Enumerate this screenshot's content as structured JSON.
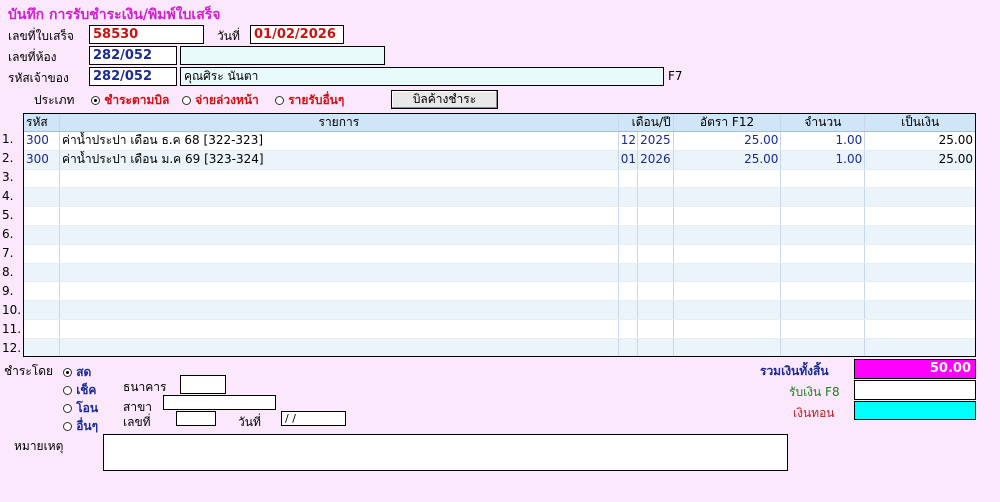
{
  "title": "บันทึก การรับชำระเงิน/พิมพ์ใบเสร็จ",
  "receipt": {
    "label": "เลขที่ใบเสร็จ",
    "value": "58530"
  },
  "date": {
    "label": "วันที่",
    "value": "01/02/2026"
  },
  "room": {
    "label": "เลขที่ห้อง",
    "value": "282/052",
    "extra": ""
  },
  "owner": {
    "label": "รหัสเจ้าของ",
    "code": "282/052",
    "name": "คุณศิระ นันตา",
    "hotkey": "F7"
  },
  "type": {
    "label": "ประเภท",
    "options": [
      "ชำระตามบิล",
      "จ่ายล่วงหน้า",
      "รายรับอื่นๆ"
    ],
    "selected": 0,
    "button": "บิลค้างชำระ"
  },
  "table": {
    "headers": {
      "code": "รหัส",
      "item": "รายการ",
      "month_year": "เดือน/ปี",
      "rate": "อัตรา F12",
      "qty": "จำนวน",
      "amount": "เป็นเงิน"
    },
    "row_numbers": [
      "1.",
      "2.",
      "3.",
      "4.",
      "5.",
      "6.",
      "7.",
      "8.",
      "9.",
      "10.",
      "11.",
      "12."
    ],
    "rows": [
      {
        "code": "300",
        "item": "ค่าน้ำประปา เดือน ธ.ค 68 [322-323]",
        "month": "12",
        "year": "2025",
        "rate": "25.00",
        "qty": "1.00",
        "amount": "25.00"
      },
      {
        "code": "300",
        "item": "ค่าน้ำประปา เดือน ม.ค 69 [323-324]",
        "month": "01",
        "year": "2026",
        "rate": "25.00",
        "qty": "1.00",
        "amount": "25.00"
      }
    ]
  },
  "payment": {
    "label": "ชำระโดย",
    "methods": [
      "สด",
      "เช็ค",
      "โอน",
      "อื่นๆ"
    ],
    "selected": 0,
    "bank_label": "ธนาคาร",
    "branch_label": "สาขา",
    "number_label": "เลขที่",
    "date_label": "วันที่",
    "date_value": " / /"
  },
  "totals": {
    "total_label": "รวมเงินทั้งสิ้น",
    "total_value": "50.00",
    "received_label": "รับเงิน F8",
    "received_value": "",
    "change_label": "เงินทอน",
    "change_value": ""
  },
  "remark": {
    "label": "หมายเหตุ",
    "value": ""
  },
  "colors": {
    "background": "#fce8fc",
    "title": "#d020d0",
    "total_bg": "#ff00ff",
    "change_bg": "#00ffff",
    "header_bg": "#cfe6f8"
  }
}
